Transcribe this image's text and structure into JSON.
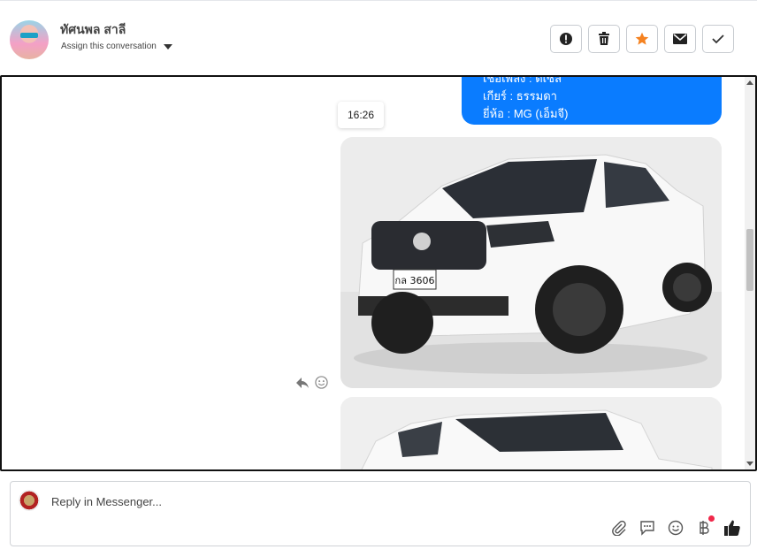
{
  "header": {
    "contact_name": "ทัศนพล สาลี",
    "assign_label": "Assign this conversation",
    "actions": [
      "spam",
      "delete",
      "star",
      "mark-unread",
      "done"
    ],
    "star_color": "#f58220"
  },
  "chat": {
    "bubble_lines": [
      "เชื้อเพลิง : ดีเซล",
      "เกียร์ : ธรรมดา",
      "ยี่ห้อ : MG (เอ็มจี)"
    ],
    "bubble_color": "#0a7cff",
    "timestamp": "16:26",
    "plate_text": "กล 3606"
  },
  "composer": {
    "placeholder": "Reply in Messenger...",
    "tools": [
      "paperclip-icon",
      "saved-reply-icon",
      "emoji-icon",
      "baht-icon",
      "thumbs-up-icon"
    ]
  }
}
